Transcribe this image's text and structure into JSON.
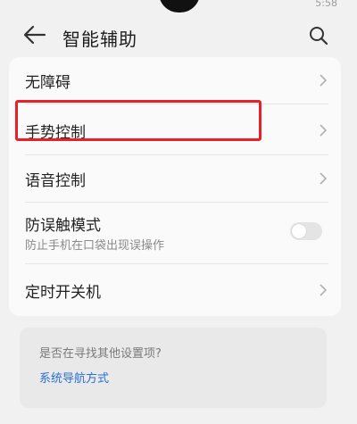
{
  "status": {
    "time": "5:58"
  },
  "header": {
    "title": "智能辅助",
    "back_icon": "arrow-left-icon",
    "search_icon": "search-icon"
  },
  "rows": [
    {
      "label": "无障碍"
    },
    {
      "label": "手势控制"
    },
    {
      "label": "语音控制"
    },
    {
      "label": "防误触模式",
      "sub": "防止手机在口袋出现误操作",
      "toggle_on": false
    },
    {
      "label": "定时开关机"
    }
  ],
  "suggest": {
    "question": "是否在寻找其他设置项?",
    "link": "系统导航方式"
  },
  "colors": {
    "highlight": "#e8202a",
    "link": "#2a6fd6",
    "background": "#f1f1f1"
  }
}
